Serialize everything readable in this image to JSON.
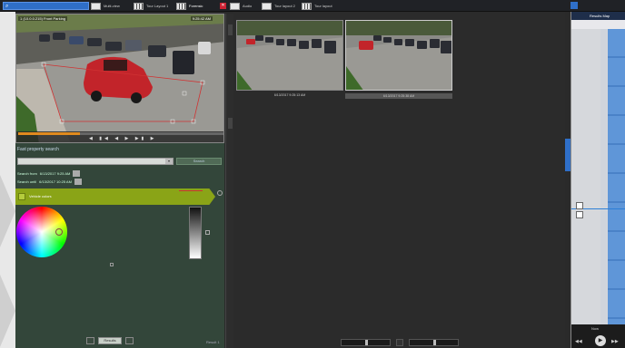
{
  "topbar": {
    "search_value": "",
    "tabs": [
      {
        "label": "Multi-view",
        "icon": "monitor-icon"
      },
      {
        "label": "Tour Layout 1",
        "icon": "grid-icon"
      },
      {
        "label": "Forensic",
        "icon": "grid-icon"
      },
      {
        "label": "Audio",
        "icon": "monitor-icon"
      },
      {
        "label": "Tour layout 2",
        "icon": "monitor-icon"
      },
      {
        "label": "Tour layout",
        "icon": "grid-icon"
      }
    ],
    "close_glyph": "✕"
  },
  "main_camera": {
    "title": "1 (10.0.0.215) Front Parking",
    "timestamp": "9:25:42 AM",
    "control_glyphs": "◀ ▮◀ ◀ ▶ ▶▮ ▶"
  },
  "forensic_panel": {
    "title": "Fast property search",
    "camera_value": "",
    "search_button": "Search",
    "search_from_label": "Search from",
    "search_from_value": "6/13/2017  9:25 AM",
    "search_to_label": "Search until",
    "search_to_value": "6/13/2017  10:25 AM",
    "color_header_label": "Vehicle colors",
    "page_label": "Results",
    "result_count": "Result 1"
  },
  "thumbnails": [
    {
      "caption": "6/13/2017 9:25:13 AM"
    },
    {
      "caption": "6/13/2017 9:25:38 AM"
    }
  ],
  "timeline": {
    "header": "Results Map",
    "footer_label": "Now",
    "play_glyph": "▶",
    "nav_prev": "◀◀",
    "nav_next": "▶▶"
  },
  "colors": {
    "accent_blue": "#2f6fc8",
    "color_header": "#8aa417",
    "panel_bg": "#33463a",
    "seek_fill": "#e08a1e"
  }
}
